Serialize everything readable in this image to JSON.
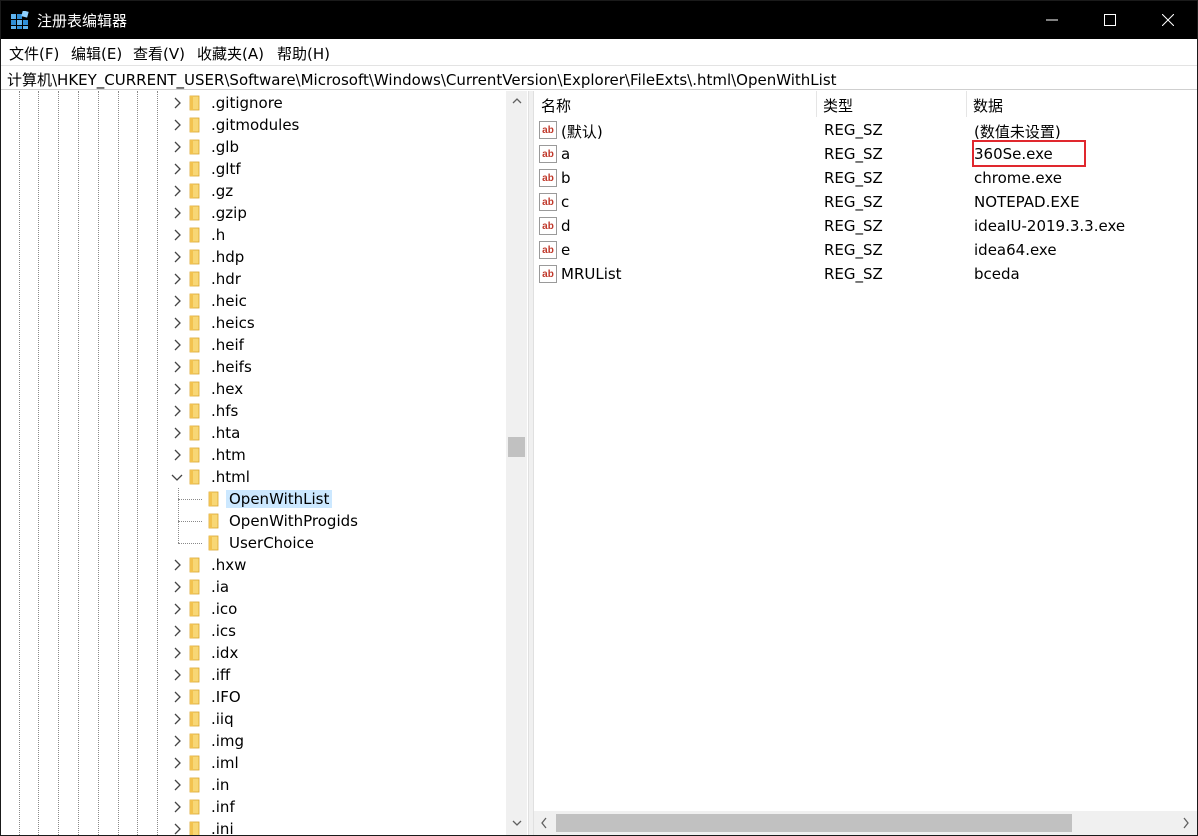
{
  "window": {
    "title": "注册表编辑器",
    "icon": "regedit-icon"
  },
  "menu": [
    "文件(F)",
    "编辑(E)",
    "查看(V)",
    "收藏夹(A)",
    "帮助(H)"
  ],
  "address": "计算机\\HKEY_CURRENT_USER\\Software\\Microsoft\\Windows\\CurrentVersion\\Explorer\\FileExts\\.html\\OpenWithList",
  "tree": {
    "keys": [
      ".gitignore",
      ".gitmodules",
      ".glb",
      ".gltf",
      ".gz",
      ".gzip",
      ".h",
      ".hdp",
      ".hdr",
      ".heic",
      ".heics",
      ".heif",
      ".heifs",
      ".hex",
      ".hfs",
      ".hta",
      ".htm",
      ".html"
    ],
    "expanded_key": ".html",
    "children": [
      "OpenWithList",
      "OpenWithProgids",
      "UserChoice"
    ],
    "selected_child": "OpenWithList",
    "keys_after": [
      ".hxw",
      ".ia",
      ".ico",
      ".ics",
      ".idx",
      ".iff",
      ".IFO",
      ".iiq",
      ".img",
      ".iml",
      ".in",
      ".inf",
      ".ini"
    ]
  },
  "list": {
    "columns": [
      "名称",
      "类型",
      "数据"
    ],
    "rows": [
      {
        "name": "(默认)",
        "type": "REG_SZ",
        "data": "(数值未设置)"
      },
      {
        "name": "a",
        "type": "REG_SZ",
        "data": "360Se.exe"
      },
      {
        "name": "b",
        "type": "REG_SZ",
        "data": "chrome.exe"
      },
      {
        "name": "c",
        "type": "REG_SZ",
        "data": "NOTEPAD.EXE"
      },
      {
        "name": "d",
        "type": "REG_SZ",
        "data": "ideaIU-2019.3.3.exe"
      },
      {
        "name": "e",
        "type": "REG_SZ",
        "data": "idea64.exe"
      },
      {
        "name": "MRUList",
        "type": "REG_SZ",
        "data": "bceda"
      }
    ],
    "highlighted_row": "a"
  },
  "colors": {
    "titlebar": "#000000",
    "selection": "#cce8ff",
    "folder": "#f8d775",
    "highlight_border": "#e0282e",
    "reg_icon_text": "#c0392b"
  }
}
